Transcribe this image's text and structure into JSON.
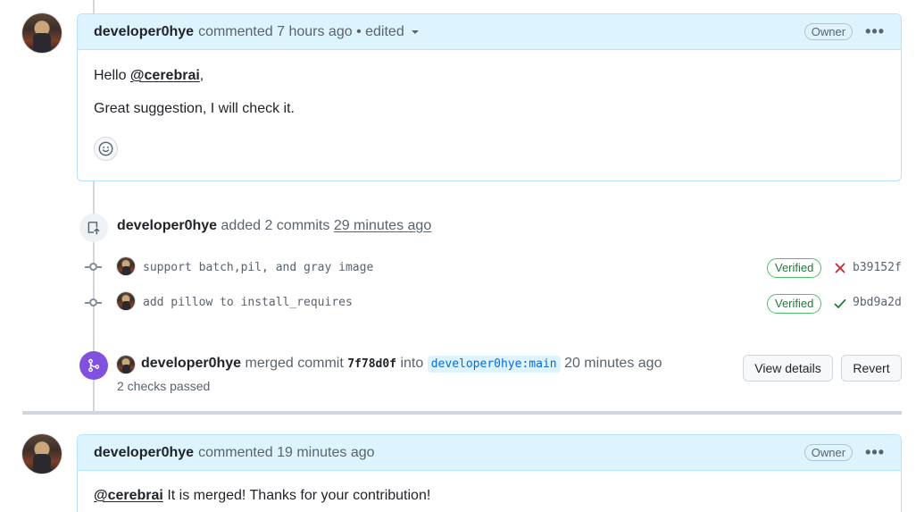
{
  "comment1": {
    "author": "developer0hye",
    "action": "commented",
    "time": "7 hours ago",
    "edited": "• edited",
    "owner_badge": "Owner",
    "menu": "•••",
    "greeting": "Hello",
    "mention": "@cerebrai",
    "comma": ",",
    "body": "Great suggestion, I will check it."
  },
  "commits_event": {
    "author": "developer0hye",
    "action": "added 2 commits",
    "time": "29 minutes ago",
    "commits": [
      {
        "message": "support batch,pil, and gray image",
        "verified": "Verified",
        "status": "failure",
        "sha": "b39152f"
      },
      {
        "message": "add pillow to install_requires",
        "verified": "Verified",
        "status": "success",
        "sha": "9bd9a2d"
      }
    ]
  },
  "merge_event": {
    "author": "developer0hye",
    "action": "merged commit",
    "commit": "7f78d0f",
    "into": "into",
    "branch": "developer0hye:main",
    "time": "20 minutes ago",
    "checks": "2 checks passed",
    "view_details": "View details",
    "revert": "Revert"
  },
  "comment2": {
    "author": "developer0hye",
    "action": "commented",
    "time": "19 minutes ago",
    "owner_badge": "Owner",
    "menu": "•••",
    "mention": "@cerebrai",
    "body": "It is merged! Thanks for your contribution!"
  },
  "colors": {
    "merged_purple": "#8250df",
    "success_green": "#1a7f37",
    "failure_red": "#d1242f",
    "header_blue": "#ddf4ff",
    "link_blue": "#0969da"
  }
}
